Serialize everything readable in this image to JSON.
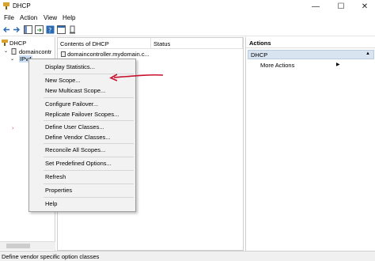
{
  "window": {
    "title": "DHCP",
    "min": "—",
    "max": "☐",
    "close": "✕"
  },
  "menu": [
    "File",
    "Action",
    "View",
    "Help"
  ],
  "tree": {
    "root": "DHCP",
    "server": "domaincontr",
    "ipv4": "IPv4"
  },
  "content": {
    "col_name": "Contents of DHCP",
    "col_status": "Status",
    "row": "domaincontroller.mydomain.c..."
  },
  "actions": {
    "header": "Actions",
    "group": "DHCP",
    "item": "More Actions"
  },
  "context_menu": [
    "Display Statistics...",
    "New Scope...",
    "New Multicast Scope...",
    "Configure Failover...",
    "Replicate Failover Scopes...",
    "Define User Classes...",
    "Define Vendor Classes...",
    "Reconcile All Scopes...",
    "Set Predefined Options...",
    "Refresh",
    "Properties",
    "Help"
  ],
  "status_text": "Define vendor specific option classes",
  "colors": {
    "arrow": "#c8102e",
    "selection": "#d9e4f1"
  }
}
